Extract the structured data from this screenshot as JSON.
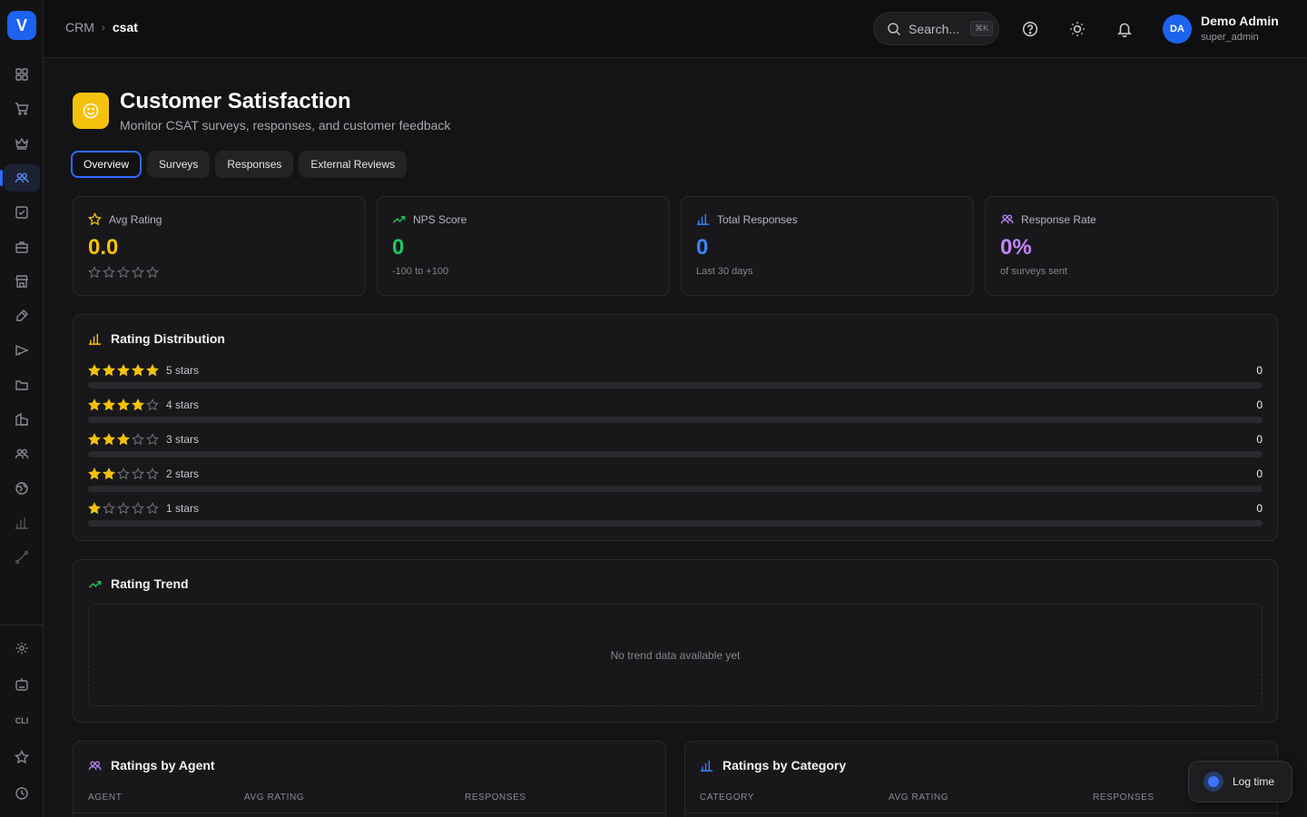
{
  "app": {
    "logo_letter": "V"
  },
  "colors": {
    "accent": "#1d63f0",
    "yellow": "#f4c20d",
    "green": "#22c55e",
    "blue": "#3b82f6",
    "purple": "#c084fc"
  },
  "sidebar": {
    "items": [
      {
        "name": "dashboard",
        "icon": "grid-icon"
      },
      {
        "name": "sales",
        "icon": "cart-icon"
      },
      {
        "name": "loyalty",
        "icon": "crown-icon"
      },
      {
        "name": "crm",
        "icon": "users-icon",
        "active": true
      },
      {
        "name": "tasks",
        "icon": "checkbox-icon"
      },
      {
        "name": "hr",
        "icon": "briefcase-icon"
      },
      {
        "name": "store",
        "icon": "store-icon"
      },
      {
        "name": "design",
        "icon": "pen-icon"
      },
      {
        "name": "marketing",
        "icon": "megaphone-icon"
      },
      {
        "name": "files",
        "icon": "folder-icon"
      },
      {
        "name": "buildings",
        "icon": "building-icon"
      },
      {
        "name": "team",
        "icon": "team-icon"
      },
      {
        "name": "web",
        "icon": "globe-icon"
      },
      {
        "name": "reports",
        "icon": "bar-chart-icon"
      },
      {
        "name": "integrations",
        "icon": "link-icon"
      }
    ],
    "bottom": [
      {
        "name": "settings",
        "icon": "gear-icon"
      },
      {
        "name": "bot",
        "icon": "robot-icon"
      },
      {
        "name": "cli",
        "label": "CLI"
      },
      {
        "name": "favorites",
        "icon": "star-icon"
      },
      {
        "name": "history",
        "icon": "clock-icon"
      }
    ]
  },
  "header": {
    "breadcrumb": [
      "CRM",
      "csat"
    ],
    "search_placeholder": "Search...",
    "search_shortcut": "⌘K",
    "user": {
      "initials": "DA",
      "name": "Demo Admin",
      "role": "super_admin"
    }
  },
  "page": {
    "title": "Customer Satisfaction",
    "subtitle": "Monitor CSAT surveys, responses, and customer feedback"
  },
  "tabs": [
    {
      "label": "Overview",
      "active": true
    },
    {
      "label": "Surveys"
    },
    {
      "label": "Responses"
    },
    {
      "label": "External Reviews"
    }
  ],
  "stats": [
    {
      "label": "Avg Rating",
      "value": "0.0",
      "note": "",
      "color": "#f4c20d",
      "icon": "star-outline-icon"
    },
    {
      "label": "NPS Score",
      "value": "0",
      "note": "-100 to +100",
      "color": "#22c55e",
      "icon": "trend-up-icon"
    },
    {
      "label": "Total Responses",
      "value": "0",
      "note": "Last 30 days",
      "color": "#3b82f6",
      "icon": "bar-chart-icon"
    },
    {
      "label": "Response Rate",
      "value": "0%",
      "note": "of surveys sent",
      "color": "#c084fc",
      "icon": "users-icon"
    }
  ],
  "distribution": {
    "title": "Rating Distribution",
    "rows": [
      {
        "stars": 5,
        "label": "5 stars",
        "count": "0",
        "fraction": 0
      },
      {
        "stars": 4,
        "label": "4 stars",
        "count": "0",
        "fraction": 0
      },
      {
        "stars": 3,
        "label": "3 stars",
        "count": "0",
        "fraction": 0
      },
      {
        "stars": 2,
        "label": "2 stars",
        "count": "0",
        "fraction": 0
      },
      {
        "stars": 1,
        "label": "1 stars",
        "count": "0",
        "fraction": 0
      }
    ]
  },
  "trend": {
    "title": "Rating Trend",
    "empty": "No trend data available yet"
  },
  "agents": {
    "title": "Ratings by Agent",
    "columns": [
      "AGENT",
      "AVG RATING",
      "RESPONSES"
    ]
  },
  "categories": {
    "title": "Ratings by Category",
    "columns": [
      "CATEGORY",
      "AVG RATING",
      "RESPONSES"
    ]
  },
  "log_time": {
    "label": "Log time"
  }
}
